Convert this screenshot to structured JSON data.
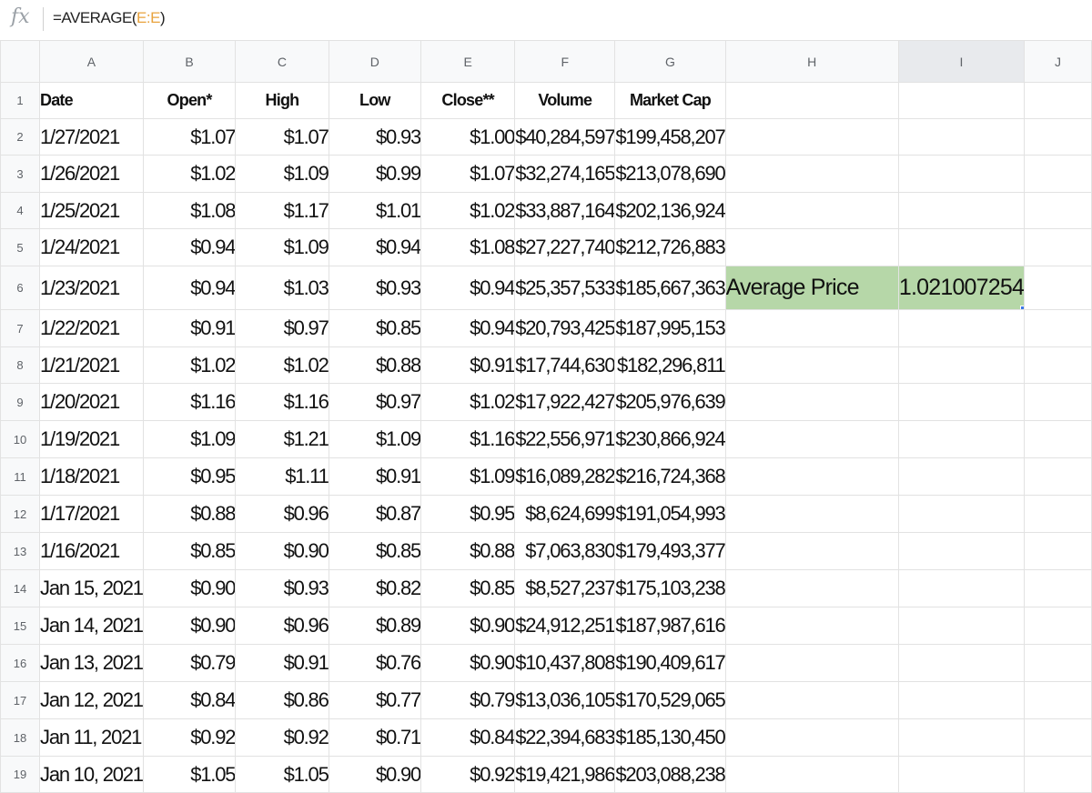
{
  "formula_bar": {
    "icon": "fx-icon",
    "formula_prefix": "=AVERAGE(",
    "formula_ref": "E:E",
    "formula_suffix": ")"
  },
  "columns": [
    "A",
    "B",
    "C",
    "D",
    "E",
    "F",
    "G",
    "H",
    "I",
    "J"
  ],
  "header_row": {
    "row_number": "1",
    "date": "Date",
    "open": "Open*",
    "high": "High",
    "low": "Low",
    "close": "Close**",
    "volume": "Volume",
    "market_cap": "Market Cap"
  },
  "rows": [
    {
      "n": "2",
      "date": "1/27/2021",
      "open": "$1.07",
      "high": "$1.07",
      "low": "$0.93",
      "close": "$1.00",
      "volume": "$40,284,597",
      "market_cap": "$199,458,207"
    },
    {
      "n": "3",
      "date": "1/26/2021",
      "open": "$1.02",
      "high": "$1.09",
      "low": "$0.99",
      "close": "$1.07",
      "volume": "$32,274,165",
      "market_cap": "$213,078,690"
    },
    {
      "n": "4",
      "date": "1/25/2021",
      "open": "$1.08",
      "high": "$1.17",
      "low": "$1.01",
      "close": "$1.02",
      "volume": "$33,887,164",
      "market_cap": "$202,136,924"
    },
    {
      "n": "5",
      "date": "1/24/2021",
      "open": "$0.94",
      "high": "$1.09",
      "low": "$0.94",
      "close": "$1.08",
      "volume": "$27,227,740",
      "market_cap": "$212,726,883"
    },
    {
      "n": "6",
      "date": "1/23/2021",
      "open": "$0.94",
      "high": "$1.03",
      "low": "$0.93",
      "close": "$0.94",
      "volume": "$25,357,533",
      "market_cap": "$185,667,363"
    },
    {
      "n": "7",
      "date": "1/22/2021",
      "open": "$0.91",
      "high": "$0.97",
      "low": "$0.85",
      "close": "$0.94",
      "volume": "$20,793,425",
      "market_cap": "$187,995,153"
    },
    {
      "n": "8",
      "date": "1/21/2021",
      "open": "$1.02",
      "high": "$1.02",
      "low": "$0.88",
      "close": "$0.91",
      "volume": "$17,744,630",
      "market_cap": "$182,296,811"
    },
    {
      "n": "9",
      "date": "1/20/2021",
      "open": "$1.16",
      "high": "$1.16",
      "low": "$0.97",
      "close": "$1.02",
      "volume": "$17,922,427",
      "market_cap": "$205,976,639"
    },
    {
      "n": "10",
      "date": "1/19/2021",
      "open": "$1.09",
      "high": "$1.21",
      "low": "$1.09",
      "close": "$1.16",
      "volume": "$22,556,971",
      "market_cap": "$230,866,924"
    },
    {
      "n": "11",
      "date": "1/18/2021",
      "open": "$0.95",
      "high": "$1.11",
      "low": "$0.91",
      "close": "$1.09",
      "volume": "$16,089,282",
      "market_cap": "$216,724,368"
    },
    {
      "n": "12",
      "date": "1/17/2021",
      "open": "$0.88",
      "high": "$0.96",
      "low": "$0.87",
      "close": "$0.95",
      "volume": "$8,624,699",
      "market_cap": "$191,054,993"
    },
    {
      "n": "13",
      "date": "1/16/2021",
      "open": "$0.85",
      "high": "$0.90",
      "low": "$0.85",
      "close": "$0.88",
      "volume": "$7,063,830",
      "market_cap": "$179,493,377"
    },
    {
      "n": "14",
      "date": "Jan 15, 2021",
      "open": "$0.90",
      "high": "$0.93",
      "low": "$0.82",
      "close": "$0.85",
      "volume": "$8,527,237",
      "market_cap": "$175,103,238"
    },
    {
      "n": "15",
      "date": "Jan 14, 2021",
      "open": "$0.90",
      "high": "$0.96",
      "low": "$0.89",
      "close": "$0.90",
      "volume": "$24,912,251",
      "market_cap": "$187,987,616"
    },
    {
      "n": "16",
      "date": "Jan 13, 2021",
      "open": "$0.79",
      "high": "$0.91",
      "low": "$0.76",
      "close": "$0.90",
      "volume": "$10,437,808",
      "market_cap": "$190,409,617"
    },
    {
      "n": "17",
      "date": "Jan 12, 2021",
      "open": "$0.84",
      "high": "$0.86",
      "low": "$0.77",
      "close": "$0.79",
      "volume": "$13,036,105",
      "market_cap": "$170,529,065"
    },
    {
      "n": "18",
      "date": "Jan 11, 2021",
      "open": "$0.92",
      "high": "$0.92",
      "low": "$0.71",
      "close": "$0.84",
      "volume": "$22,394,683",
      "market_cap": "$185,130,450"
    },
    {
      "n": "19",
      "date": "Jan 10, 2021",
      "open": "$1.05",
      "high": "$1.05",
      "low": "$0.90",
      "close": "$0.92",
      "volume": "$19,421,986",
      "market_cap": "$203,088,238"
    }
  ],
  "average_box": {
    "label": "Average Price",
    "value": "1.021007254"
  },
  "colors": {
    "avg_fill": "#b6d7a8",
    "selection": "#3b78e7",
    "formula_ref": "#e8a33d"
  }
}
